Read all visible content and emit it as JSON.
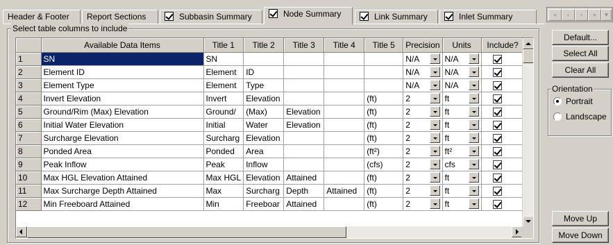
{
  "tabs": [
    {
      "label": "Header & Footer",
      "checkbox": false,
      "active": false
    },
    {
      "label": "Report Sections",
      "checkbox": false,
      "active": false
    },
    {
      "label": "Subbasin Summary",
      "checkbox": true,
      "active": false
    },
    {
      "label": "Node Summary",
      "checkbox": true,
      "active": true
    },
    {
      "label": "Link Summary",
      "checkbox": true,
      "active": false
    },
    {
      "label": "Inlet Summary",
      "checkbox": true,
      "active": false
    }
  ],
  "tab_nav": [
    "first-page-icon",
    "prev-page-icon",
    "next-page-icon",
    "last-page-icon",
    "more-icon"
  ],
  "group_label": "Select table columns to include",
  "columns": {
    "rownum": "",
    "item": "Available Data Items",
    "t1": "Title 1",
    "t2": "Title 2",
    "t3": "Title 3",
    "t4": "Title 4",
    "t5": "Title 5",
    "precision": "Precision",
    "units": "Units",
    "include": "Include?"
  },
  "rows": [
    {
      "n": "1",
      "item": "SN",
      "t1": "SN",
      "t2": "",
      "t3": "",
      "t4": "",
      "t5": "",
      "precision": "N/A",
      "units": "N/A",
      "include": true
    },
    {
      "n": "2",
      "item": "Element ID",
      "t1": "Element",
      "t2": "ID",
      "t3": "",
      "t4": "",
      "t5": "",
      "precision": "N/A",
      "units": "N/A",
      "include": true
    },
    {
      "n": "3",
      "item": "Element Type",
      "t1": "Element",
      "t2": "Type",
      "t3": "",
      "t4": "",
      "t5": "",
      "precision": "N/A",
      "units": "N/A",
      "include": true
    },
    {
      "n": "4",
      "item": "Invert Elevation",
      "t1": "Invert",
      "t2": "Elevation",
      "t3": "",
      "t4": "",
      "t5": "(ft)",
      "precision": "2",
      "units": "ft",
      "include": true
    },
    {
      "n": "5",
      "item": "Ground/Rim (Max) Elevation",
      "t1": "Ground/",
      "t2": "(Max)",
      "t3": "Elevation",
      "t4": "",
      "t5": "(ft)",
      "precision": "2",
      "units": "ft",
      "include": true
    },
    {
      "n": "6",
      "item": "Initial Water Elevation",
      "t1": "Initial",
      "t2": "Water",
      "t3": "Elevation",
      "t4": "",
      "t5": "(ft)",
      "precision": "2",
      "units": "ft",
      "include": true
    },
    {
      "n": "7",
      "item": "Surcharge Elevation",
      "t1": "Surcharg",
      "t2": "Elevation",
      "t3": "",
      "t4": "",
      "t5": "(ft)",
      "precision": "2",
      "units": "ft",
      "include": true
    },
    {
      "n": "8",
      "item": "Ponded Area",
      "t1": "Ponded",
      "t2": "Area",
      "t3": "",
      "t4": "",
      "t5": "(ft²)",
      "precision": "2",
      "units": "ft²",
      "include": true
    },
    {
      "n": "9",
      "item": "Peak Inflow",
      "t1": "Peak",
      "t2": "Inflow",
      "t3": "",
      "t4": "",
      "t5": "(cfs)",
      "precision": "2",
      "units": "cfs",
      "include": true
    },
    {
      "n": "10",
      "item": "Max HGL Elevation Attained",
      "t1": "Max HGL",
      "t2": "Elevation",
      "t3": "Attained",
      "t4": "",
      "t5": "(ft)",
      "precision": "2",
      "units": "ft",
      "include": true
    },
    {
      "n": "11",
      "item": "Max Surcharge Depth Attained",
      "t1": "Max",
      "t2": "Surcharg",
      "t3": "Depth",
      "t4": "Attained",
      "t5": "(ft)",
      "precision": "2",
      "units": "ft",
      "include": true
    },
    {
      "n": "12",
      "item": "Min Freeboard Attained",
      "t1": "Min",
      "t2": "Freeboar",
      "t3": "Attained",
      "t4": "",
      "t5": "(ft)",
      "precision": "2",
      "units": "ft",
      "include": true
    }
  ],
  "selected_row": 0,
  "buttons": {
    "default": "Default...",
    "select_all": "Select All",
    "clear_all": "Clear All",
    "move_up": "Move Up",
    "move_down": "Move Down"
  },
  "orientation": {
    "label": "Orientation",
    "options": [
      "Portrait",
      "Landscape"
    ],
    "selected": "Portrait"
  }
}
